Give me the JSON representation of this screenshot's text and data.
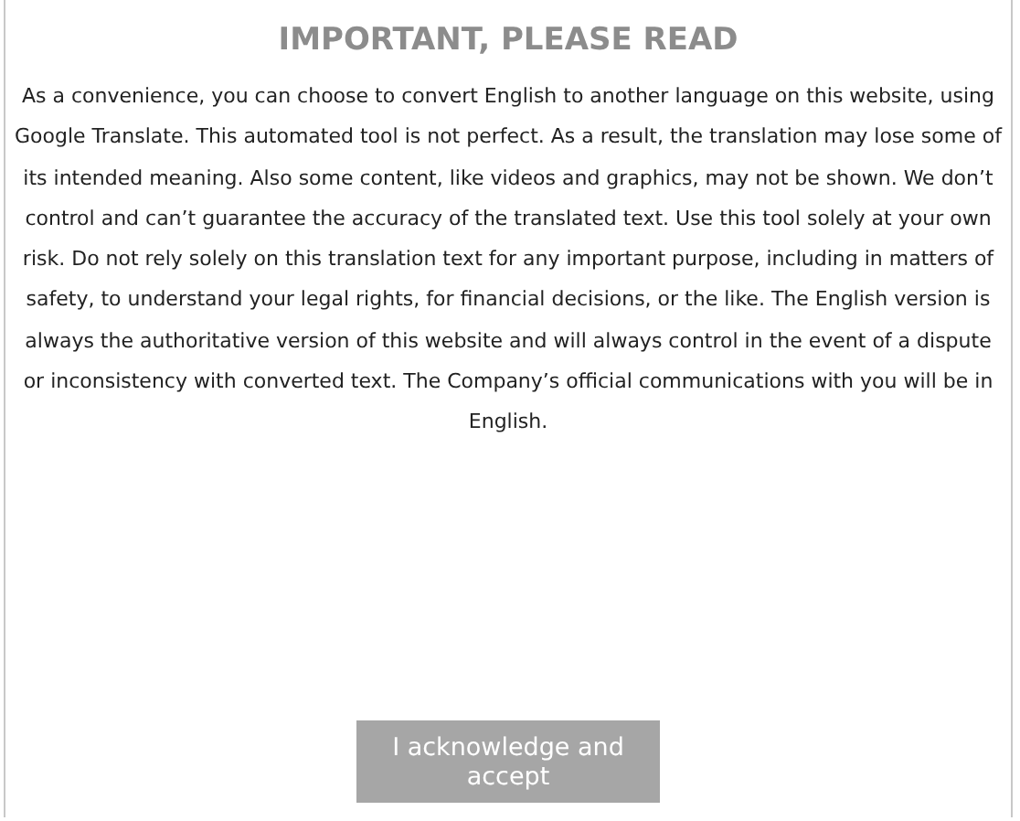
{
  "dialog": {
    "title": "IMPORTANT, PLEASE READ",
    "message": "As a convenience, you can choose to convert English to another language on this website, using Google Translate. This automated tool is not perfect. As a result, the translation may lose some of its intended meaning. Also some content, like videos and graphics, may not be shown. We don’t control and can’t guarantee the accuracy of the translated text. Use this tool solely at your own risk. Do not rely solely on this translation text for any important purpose, including in matters of safety, to understand your legal rights, for financial decisions, or the like. The English version is always the authoritative version of this website and will always control in the event of a dispute or inconsistency with converted text. The Company’s official communications with you will be in English.",
    "button": "I acknowledge and accept"
  }
}
